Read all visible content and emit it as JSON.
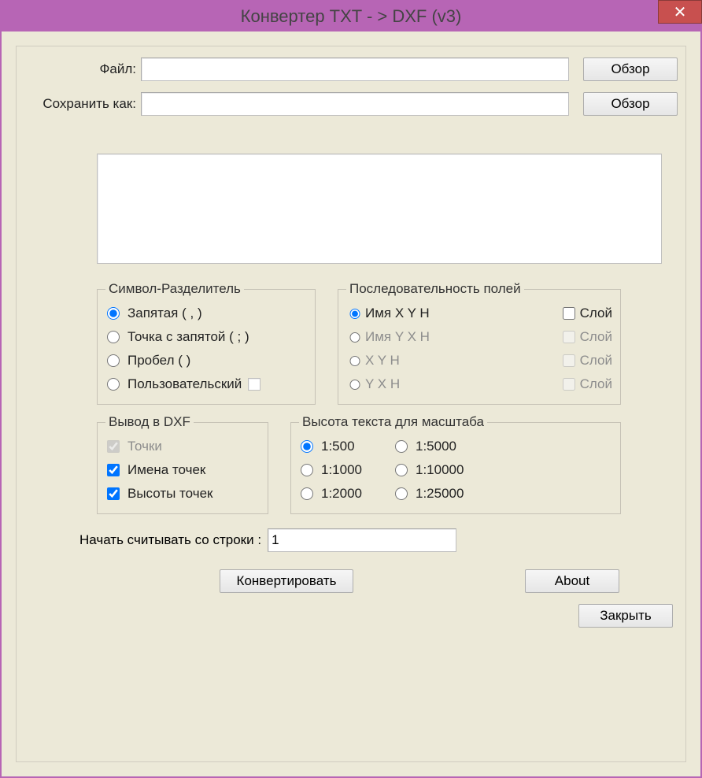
{
  "window": {
    "title": "Конвертер TXT - > DXF (v3)",
    "close_icon": "✕"
  },
  "fields": {
    "file_label": "Файл:",
    "file_value": "",
    "saveas_label": "Сохранить как:",
    "saveas_value": "",
    "browse1": "Обзор",
    "browse2": "Обзор"
  },
  "groups": {
    "delimiter": {
      "title": "Символ-Разделитель",
      "opt_comma": "Запятая ( , )",
      "opt_semicolon": "Точка с запятой ( ; )",
      "opt_space": "Пробел ( )",
      "opt_custom": "Пользовательский",
      "custom_value": ""
    },
    "sequence": {
      "title": "Последовательность полей",
      "layer_word": "Слой",
      "opt1": "Имя X Y H",
      "opt2": "Имя Y X H",
      "opt3": "X Y H",
      "opt4": "Y X H"
    },
    "output": {
      "title": "Вывод в DXF",
      "points": "Точки",
      "names": "Имена точек",
      "heights": "Высоты точек"
    },
    "scale": {
      "title": "Высота текста для масштаба",
      "s500": "1:500",
      "s1000": "1:1000",
      "s2000": "1:2000",
      "s5000": "1:5000",
      "s10000": "1:10000",
      "s25000": "1:25000"
    }
  },
  "start_line": {
    "label": "Начать считывать со строки :",
    "value": "1"
  },
  "buttons": {
    "convert": "Конвертировать",
    "about": "About",
    "close": "Закрыть"
  }
}
